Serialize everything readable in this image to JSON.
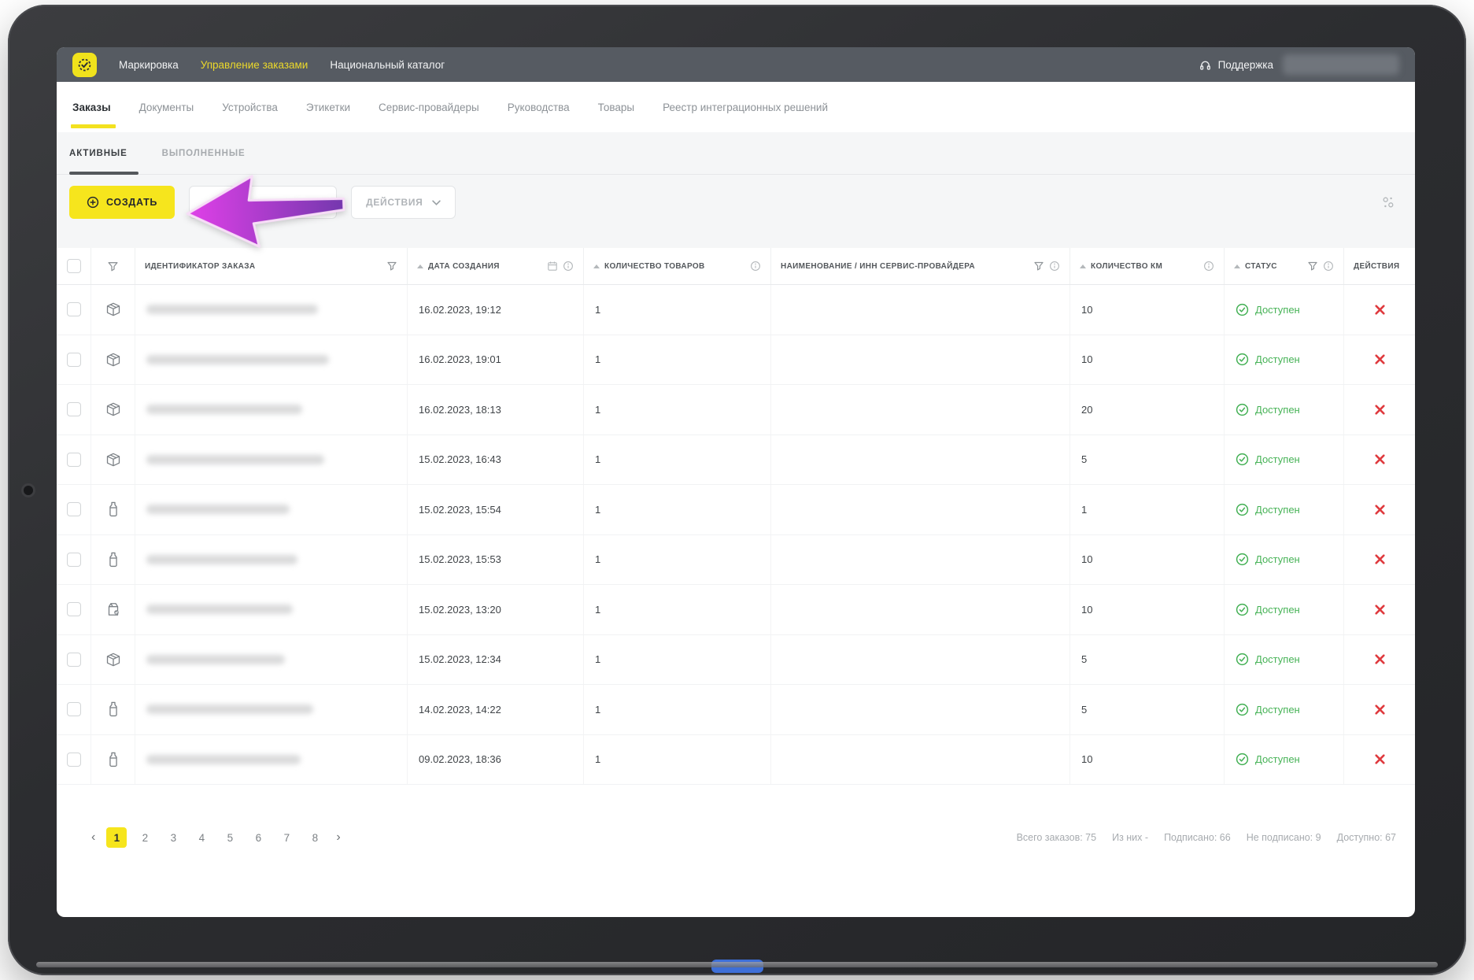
{
  "topbar": {
    "items": [
      {
        "label": "Маркировка",
        "active": false
      },
      {
        "label": "Управление заказами",
        "active": true
      },
      {
        "label": "Национальный каталог",
        "active": false
      }
    ],
    "support_label": "Поддержка",
    "user_redacted": true
  },
  "nav_tabs": {
    "items": [
      {
        "label": "Заказы",
        "active": true
      },
      {
        "label": "Документы",
        "active": false
      },
      {
        "label": "Устройства",
        "active": false
      },
      {
        "label": "Этикетки",
        "active": false
      },
      {
        "label": "Сервис-провайдеры",
        "active": false
      },
      {
        "label": "Руководства",
        "active": false
      },
      {
        "label": "Товары",
        "active": false
      },
      {
        "label": "Реестр интеграционных решений",
        "active": false
      }
    ]
  },
  "sub_tabs": {
    "items": [
      {
        "label": "АКТИВНЫЕ",
        "active": true
      },
      {
        "label": "ВЫПОЛНЕННЫЕ",
        "active": false
      }
    ]
  },
  "toolbar": {
    "create_label": "СОЗДАТЬ",
    "actions_label": "ДЕЙСТВИЯ",
    "search_value": "",
    "search_placeholder": ""
  },
  "table": {
    "headers": {
      "id": "ИДЕНТИФИКАТОР ЗАКАЗА",
      "date": "ДАТА СОЗДАНИЯ",
      "goods": "КОЛИЧЕСТВО ТОВАРОВ",
      "provider": "НАИМЕНОВАНИЕ / ИНН СЕРВИС-ПРОВАЙДЕРА",
      "km": "КОЛИЧЕСТВО КМ",
      "status": "СТАТУС",
      "actions": "ДЕЙСТВИЯ"
    },
    "rows": [
      {
        "icon": "box",
        "id_redacted": true,
        "date": "16.02.2023, 19:12",
        "goods": "1",
        "provider": "",
        "km": "10",
        "status": "Доступен"
      },
      {
        "icon": "box",
        "id_redacted": true,
        "date": "16.02.2023, 19:01",
        "goods": "1",
        "provider": "",
        "km": "10",
        "status": "Доступен"
      },
      {
        "icon": "box",
        "id_redacted": true,
        "date": "16.02.2023, 18:13",
        "goods": "1",
        "provider": "",
        "km": "20",
        "status": "Доступен"
      },
      {
        "icon": "box",
        "id_redacted": true,
        "date": "15.02.2023, 16:43",
        "goods": "1",
        "provider": "",
        "km": "5",
        "status": "Доступен"
      },
      {
        "icon": "bottle",
        "id_redacted": true,
        "date": "15.02.2023, 15:54",
        "goods": "1",
        "provider": "",
        "km": "1",
        "status": "Доступен"
      },
      {
        "icon": "bottle",
        "id_redacted": true,
        "date": "15.02.2023, 15:53",
        "goods": "1",
        "provider": "",
        "km": "10",
        "status": "Доступен"
      },
      {
        "icon": "carton",
        "id_redacted": true,
        "date": "15.02.2023, 13:20",
        "goods": "1",
        "provider": "",
        "km": "10",
        "status": "Доступен"
      },
      {
        "icon": "box",
        "id_redacted": true,
        "date": "15.02.2023, 12:34",
        "goods": "1",
        "provider": "",
        "km": "5",
        "status": "Доступен"
      },
      {
        "icon": "bottle",
        "id_redacted": true,
        "date": "14.02.2023, 14:22",
        "goods": "1",
        "provider": "",
        "km": "5",
        "status": "Доступен"
      },
      {
        "icon": "bottle",
        "id_redacted": true,
        "date": "09.02.2023, 18:36",
        "goods": "1",
        "provider": "",
        "km": "10",
        "status": "Доступен"
      }
    ]
  },
  "pagination": {
    "prev": "‹",
    "next": "›",
    "pages": [
      "1",
      "2",
      "3",
      "4",
      "5",
      "6",
      "7",
      "8"
    ],
    "active": "1"
  },
  "footer": {
    "stats": [
      "Всего заказов: 75",
      "Из них -",
      "Подписано: 66",
      "Не подписано: 9",
      "Доступно: 67"
    ]
  },
  "annotation": {
    "type": "arrow-left",
    "points_at": "create-button",
    "color_from": "#e040e8",
    "color_to": "#7438ae"
  },
  "colors": {
    "accent_yellow": "#f6e51d",
    "topbar_bg": "#565b62",
    "status_green": "#43b054",
    "danger_red": "#df3a3e"
  }
}
